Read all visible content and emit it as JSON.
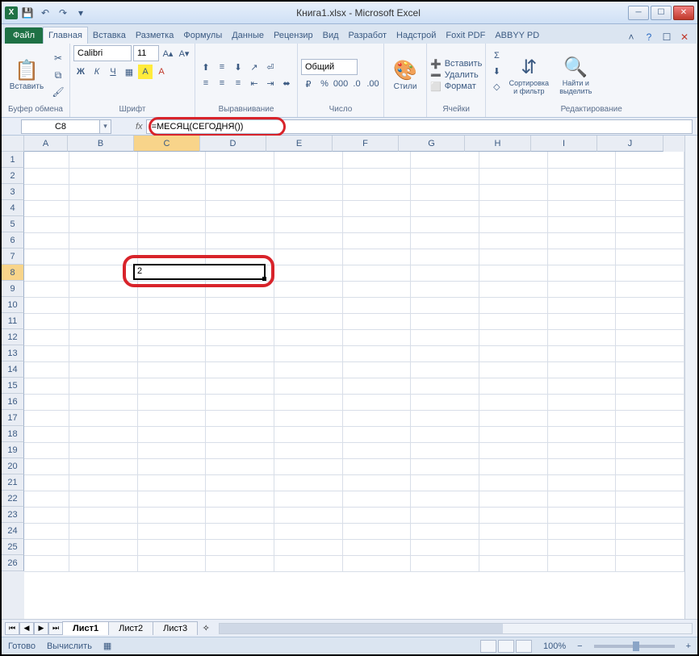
{
  "window": {
    "title": "Книга1.xlsx - Microsoft Excel"
  },
  "tabs": {
    "file": "Файл",
    "items": [
      "Главная",
      "Вставка",
      "Разметка",
      "Формулы",
      "Данные",
      "Рецензир",
      "Вид",
      "Разработ",
      "Надстрой",
      "Foxit PDF",
      "ABBYY PD"
    ],
    "active_index": 0
  },
  "ribbon": {
    "clipboard": {
      "paste": "Вставить",
      "label": "Буфер обмена"
    },
    "font": {
      "name": "Calibri",
      "size": "11",
      "label": "Шрифт"
    },
    "alignment": {
      "label": "Выравнивание"
    },
    "number": {
      "format": "Общий",
      "label": "Число"
    },
    "styles": {
      "btn": "Стили"
    },
    "cells": {
      "insert": "Вставить",
      "delete": "Удалить",
      "format": "Формат",
      "label": "Ячейки"
    },
    "editing": {
      "sort": "Сортировка и фильтр",
      "find": "Найти и выделить",
      "label": "Редактирование"
    }
  },
  "formula_row": {
    "name_box": "C8",
    "formula": "=МЕСЯЦ(СЕГОДНЯ())"
  },
  "grid": {
    "columns": [
      "A",
      "B",
      "C",
      "D",
      "E",
      "F",
      "G",
      "H",
      "I",
      "J"
    ],
    "rows": 26,
    "active_cell": "C8",
    "active_value": "2",
    "selected_col_index": 2,
    "selected_row_index": 7
  },
  "sheets": {
    "tabs": [
      "Лист1",
      "Лист2",
      "Лист3"
    ],
    "active_index": 0
  },
  "status": {
    "ready": "Готово",
    "calc": "Вычислить",
    "zoom": "100%"
  }
}
